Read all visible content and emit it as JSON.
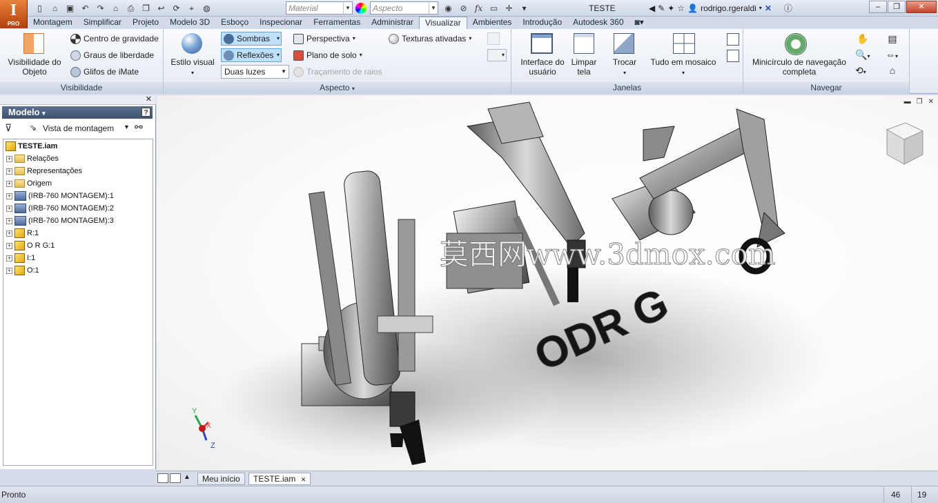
{
  "app": {
    "logo_letter": "I",
    "logo_badge": "PRO",
    "document_title": "TESTE",
    "user": "rodrigo.rgeraldi"
  },
  "qat": {
    "material_placeholder": "Material",
    "aspect_placeholder": "Aspecto"
  },
  "tabs": [
    "Montagem",
    "Simplificar",
    "Projeto",
    "Modelo 3D",
    "Esboço",
    "Inspecionar",
    "Ferramentas",
    "Administrar",
    "Visualizar",
    "Ambientes",
    "Introdução",
    "Autodesk 360"
  ],
  "active_tab": "Visualizar",
  "ribbon": {
    "visibilidade": {
      "title": "Visibilidade",
      "obj_visibility": "Visibilidade do Objeto",
      "centro": "Centro de gravidade",
      "graus": "Graus de liberdade",
      "glifos": "Glifos de iMate"
    },
    "aspecto": {
      "title": "Aspecto",
      "estilo": "Estilo visual",
      "sombras": "Sombras",
      "reflexoes": "Reflexões",
      "luzes": "Duas luzes",
      "perspectiva": "Perspectiva",
      "plano": "Plano de solo",
      "tracamento": "Traçamento de raios",
      "texturas": "Texturas ativadas"
    },
    "janelas": {
      "title": "Janelas",
      "interface": "Interface do usuário",
      "limpar": "Limpar tela",
      "trocar": "Trocar",
      "tudo": "Tudo em mosaico"
    },
    "navegar": {
      "title": "Navegar",
      "minicirculo": "Minicírculo de navegação completa"
    }
  },
  "browser": {
    "title": "Modelo",
    "view": "Vista de montagem",
    "items": [
      {
        "label": "TESTE.iam",
        "icon": "assembly-icon",
        "root": true
      },
      {
        "label": "Relações",
        "icon": "folder-icon"
      },
      {
        "label": "Representações",
        "icon": "representations-icon"
      },
      {
        "label": "Origem",
        "icon": "folder-icon"
      },
      {
        "label": "(IRB-760 MONTAGEM):1",
        "icon": "subassembly-icon"
      },
      {
        "label": "(IRB-760 MONTAGEM):2",
        "icon": "subassembly-icon"
      },
      {
        "label": "(IRB-760 MONTAGEM):3",
        "icon": "subassembly-icon"
      },
      {
        "label": "R:1",
        "icon": "part-icon"
      },
      {
        "label": "O R G:1",
        "icon": "part-icon"
      },
      {
        "label": "I:1",
        "icon": "part-icon"
      },
      {
        "label": "O:1",
        "icon": "part-icon"
      }
    ]
  },
  "viewport": {
    "watermark": "莫西网www.3dmox.com",
    "letters_text": "ODR G",
    "axis_y": "Y",
    "axis_x": "X",
    "axis_z": "Z"
  },
  "doc_tabs": {
    "home": "Meu início",
    "file": "TESTE.iam"
  },
  "status": {
    "text": "Pronto",
    "num1": "46",
    "num2": "19"
  }
}
